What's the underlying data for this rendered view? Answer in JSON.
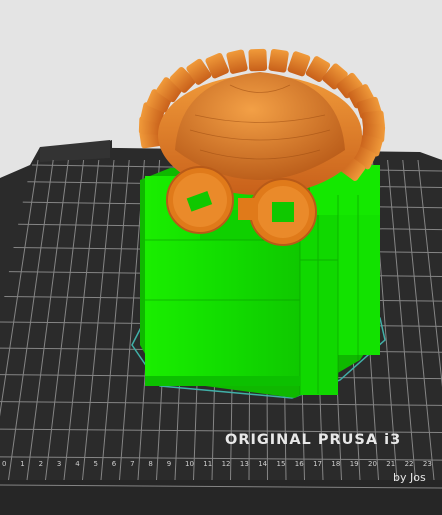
{
  "viewport": {
    "background": "#e4e4e4",
    "bed": {
      "brand_text": "ORIGINAL PRUSA i3",
      "sub_text": "by Jos",
      "ruler_labels": [
        "0",
        "1",
        "2",
        "3",
        "4",
        "5",
        "6",
        "7",
        "8",
        "9",
        "10",
        "11",
        "12",
        "13",
        "14",
        "15",
        "16",
        "17",
        "18",
        "19",
        "20",
        "21",
        "22",
        "23"
      ],
      "bed_color": "#2a2a2a",
      "grid_color": "#9a9a9a",
      "label_color": "#cfcfcf"
    },
    "model": {
      "support_color": "#14e600",
      "model_color": "#e07a1a",
      "skirt_color": "#40b0a8",
      "support_role": "support-material",
      "model_role": "printed-model"
    }
  }
}
